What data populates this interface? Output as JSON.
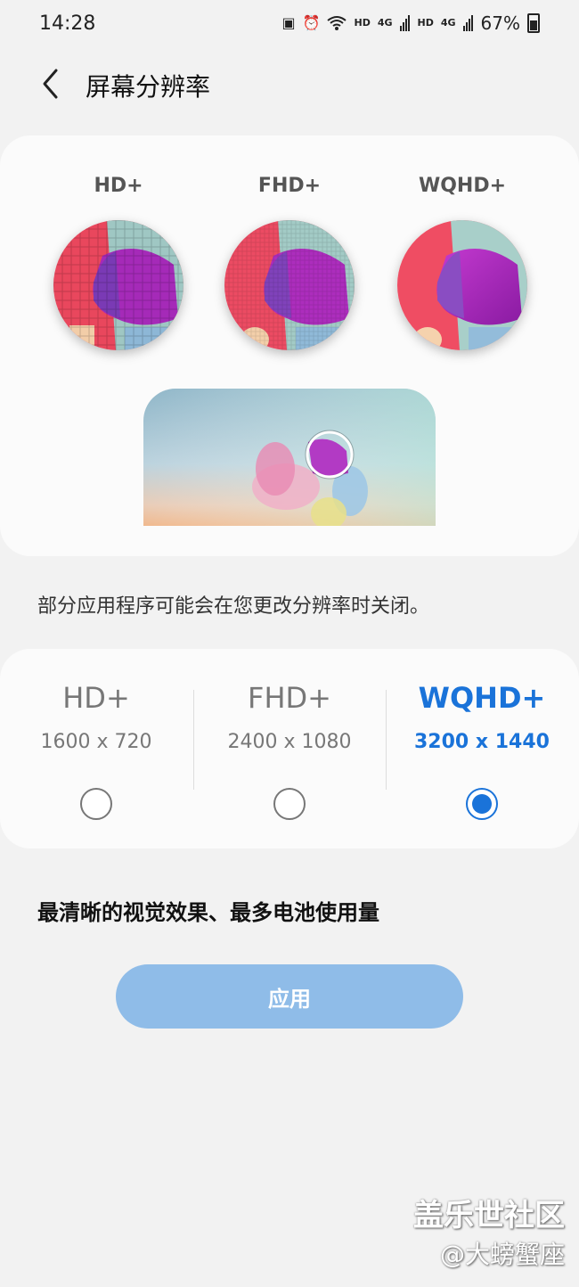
{
  "status_bar": {
    "time": "14:28",
    "network1": "HD",
    "signal1": "4G",
    "network2": "HD",
    "signal2": "4G",
    "battery": "67%"
  },
  "header": {
    "title": "屏幕分辨率"
  },
  "preview": {
    "labels": [
      "HD+",
      "FHD+",
      "WQHD+"
    ]
  },
  "note": "部分应用程序可能会在您更改分辨率时关闭。",
  "options": [
    {
      "name": "HD+",
      "resolution": "1600 x 720",
      "selected": false
    },
    {
      "name": "FHD+",
      "resolution": "2400 x 1080",
      "selected": false
    },
    {
      "name": "WQHD+",
      "resolution": "3200 x 1440",
      "selected": true
    }
  ],
  "description": "最清晰的视觉效果、最多电池使用量",
  "apply_label": "应用",
  "watermark": {
    "line1": "盖乐世社区",
    "line2": "@大螃蟹座"
  },
  "colors": {
    "accent": "#1a73d9",
    "apply_button": "#8fbce8"
  }
}
